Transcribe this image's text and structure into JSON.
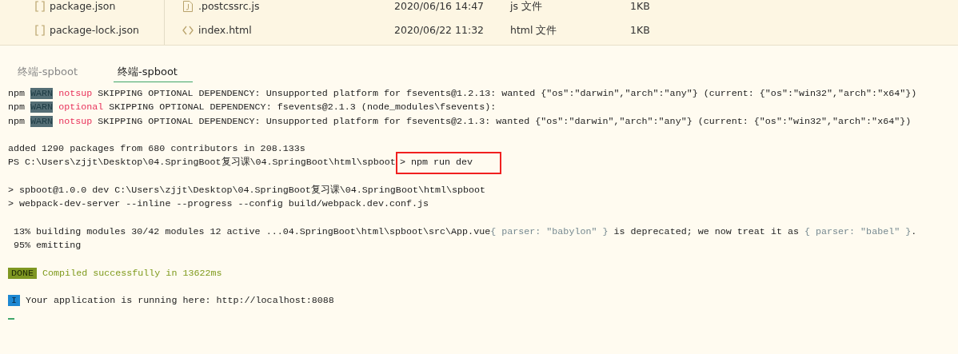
{
  "tree": [
    {
      "name": "package.json"
    },
    {
      "name": "package-lock.json"
    }
  ],
  "files": [
    {
      "kind": "script",
      "name": ".postcssrc.js",
      "date": "2020/06/16 14:47",
      "type": "js 文件",
      "size": "1KB"
    },
    {
      "kind": "code",
      "name": "index.html",
      "date": "2020/06/22 11:32",
      "type": "html 文件",
      "size": "1KB"
    }
  ],
  "tabs": [
    {
      "label": "终端-spboot",
      "selected": false
    },
    {
      "label": "终端-spboot",
      "selected": true
    }
  ],
  "terminal": [
    [
      [
        {
          "kind": "plain",
          "text": "npm "
        },
        {
          "kind": "warn",
          "text": "WARN"
        },
        {
          "kind": "pink",
          "text": "notsup"
        },
        {
          "kind": "plain",
          "text": " SKIPPING OPTIONAL DEPENDENCY: Unsupported platform for fsevents@1.2.13: wanted {\"os\":\"darwin\",\"arch\":\"any\"} (current: {\"os\":\"win32\",\"arch\":\"x64\"})"
        }
      ],
      [
        {
          "kind": "plain",
          "text": "npm "
        },
        {
          "kind": "warn",
          "text": "WARN"
        },
        {
          "kind": "pink",
          "text": "optional"
        },
        {
          "kind": "plain",
          "text": " SKIPPING OPTIONAL DEPENDENCY: fsevents@2.1.3 (node_modules\\fsevents):"
        }
      ],
      [
        {
          "kind": "plain",
          "text": "npm "
        },
        {
          "kind": "warn",
          "text": "WARN"
        },
        {
          "kind": "pink",
          "text": "notsup"
        },
        {
          "kind": "plain",
          "text": " SKIPPING OPTIONAL DEPENDENCY: Unsupported platform for fsevents@2.1.3: wanted {\"os\":\"darwin\",\"arch\":\"any\"} (current: {\"os\":\"win32\",\"arch\":\"x64\"})"
        }
      ]
    ],
    [
      [
        {
          "kind": "plain",
          "text": "added 1290 packages from 680 contributors in 208.133s"
        }
      ],
      [
        {
          "kind": "plain",
          "text": "PS C:\\Users\\zjjt\\Desktop\\04.SpringBoot复习课\\04.SpringBoot\\html\\spboot"
        },
        {
          "kind": "boxed",
          "text": "> npm run dev"
        }
      ]
    ],
    [
      [
        {
          "kind": "plain",
          "text": "> spboot@1.0.0 dev C:\\Users\\zjjt\\Desktop\\04.SpringBoot复习课\\04.SpringBoot\\html\\spboot"
        }
      ],
      [
        {
          "kind": "plain",
          "text": "> webpack-dev-server --inline --progress --config build/webpack.dev.conf.js"
        }
      ]
    ],
    [
      [
        {
          "kind": "plain",
          "text": " 13% building modules 30/42 modules 12 active ...04.SpringBoot\\html\\spboot\\src\\App.vue"
        },
        {
          "kind": "muted",
          "text": "{ parser: \"babylon\" }"
        },
        {
          "kind": "plain",
          "text": " is deprecated; we now treat it as "
        },
        {
          "kind": "muted",
          "text": "{ parser: \"babel\" }"
        },
        {
          "kind": "plain",
          "text": "."
        }
      ],
      [
        {
          "kind": "plain",
          "text": " 95% emitting"
        }
      ]
    ],
    [
      [
        {
          "kind": "done",
          "text": "DONE"
        },
        {
          "kind": "success",
          "text": "Compiled successfully in 13622ms"
        }
      ]
    ],
    [
      [
        {
          "kind": "info",
          "text": "I"
        },
        {
          "kind": "plain",
          "text": " Your application is running here: http://localhost:8088"
        }
      ]
    ]
  ]
}
